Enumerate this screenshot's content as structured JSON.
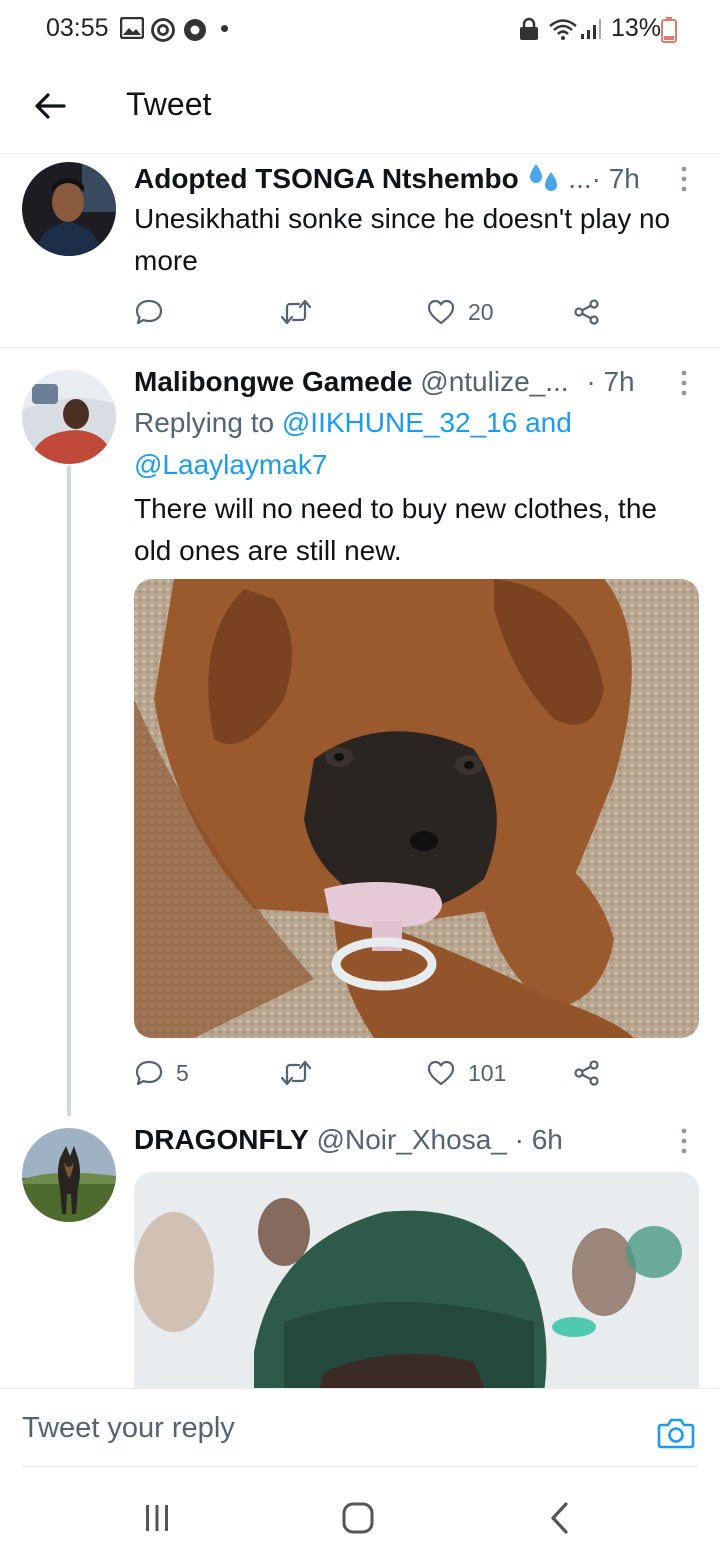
{
  "status_bar": {
    "time": "03:55",
    "battery": "13%",
    "left_icons": [
      "gallery-icon",
      "ring-icon",
      "chrome-icon"
    ],
    "right_icons": [
      "lock-icon",
      "wifi-icon",
      "signal-icon",
      "battery-icon"
    ]
  },
  "header": {
    "title": "Tweet"
  },
  "tweets": [
    {
      "name": "Adopted TSONGA Ntshembo",
      "handle_time": " ...· 7h",
      "text": "Unesikhathi sonke since he doesn't play no more",
      "replies": "",
      "retweets": "",
      "likes": "20"
    },
    {
      "name": "Malibongwe Gamede",
      "handle": " @ntulize_...",
      "time": " · 7h",
      "replying_prefix": "Replying to ",
      "mention_1": "@IIKHUNE_32_16",
      "mention_join": " and",
      "mention_2": "@Laaylaymak7",
      "text": "There will no need to buy new clothes, the old ones are still new.",
      "replies": "5",
      "retweets": "",
      "likes": "101"
    },
    {
      "name": "DRAGONFLY",
      "handle": " @Noir_Xhosa_",
      "time": " · 6h"
    }
  ],
  "reply_bar": {
    "placeholder": "Tweet your reply"
  },
  "colors": {
    "accent": "#1d9bf0",
    "secondary_text": "#536471",
    "divider": "#e6ecf0"
  }
}
